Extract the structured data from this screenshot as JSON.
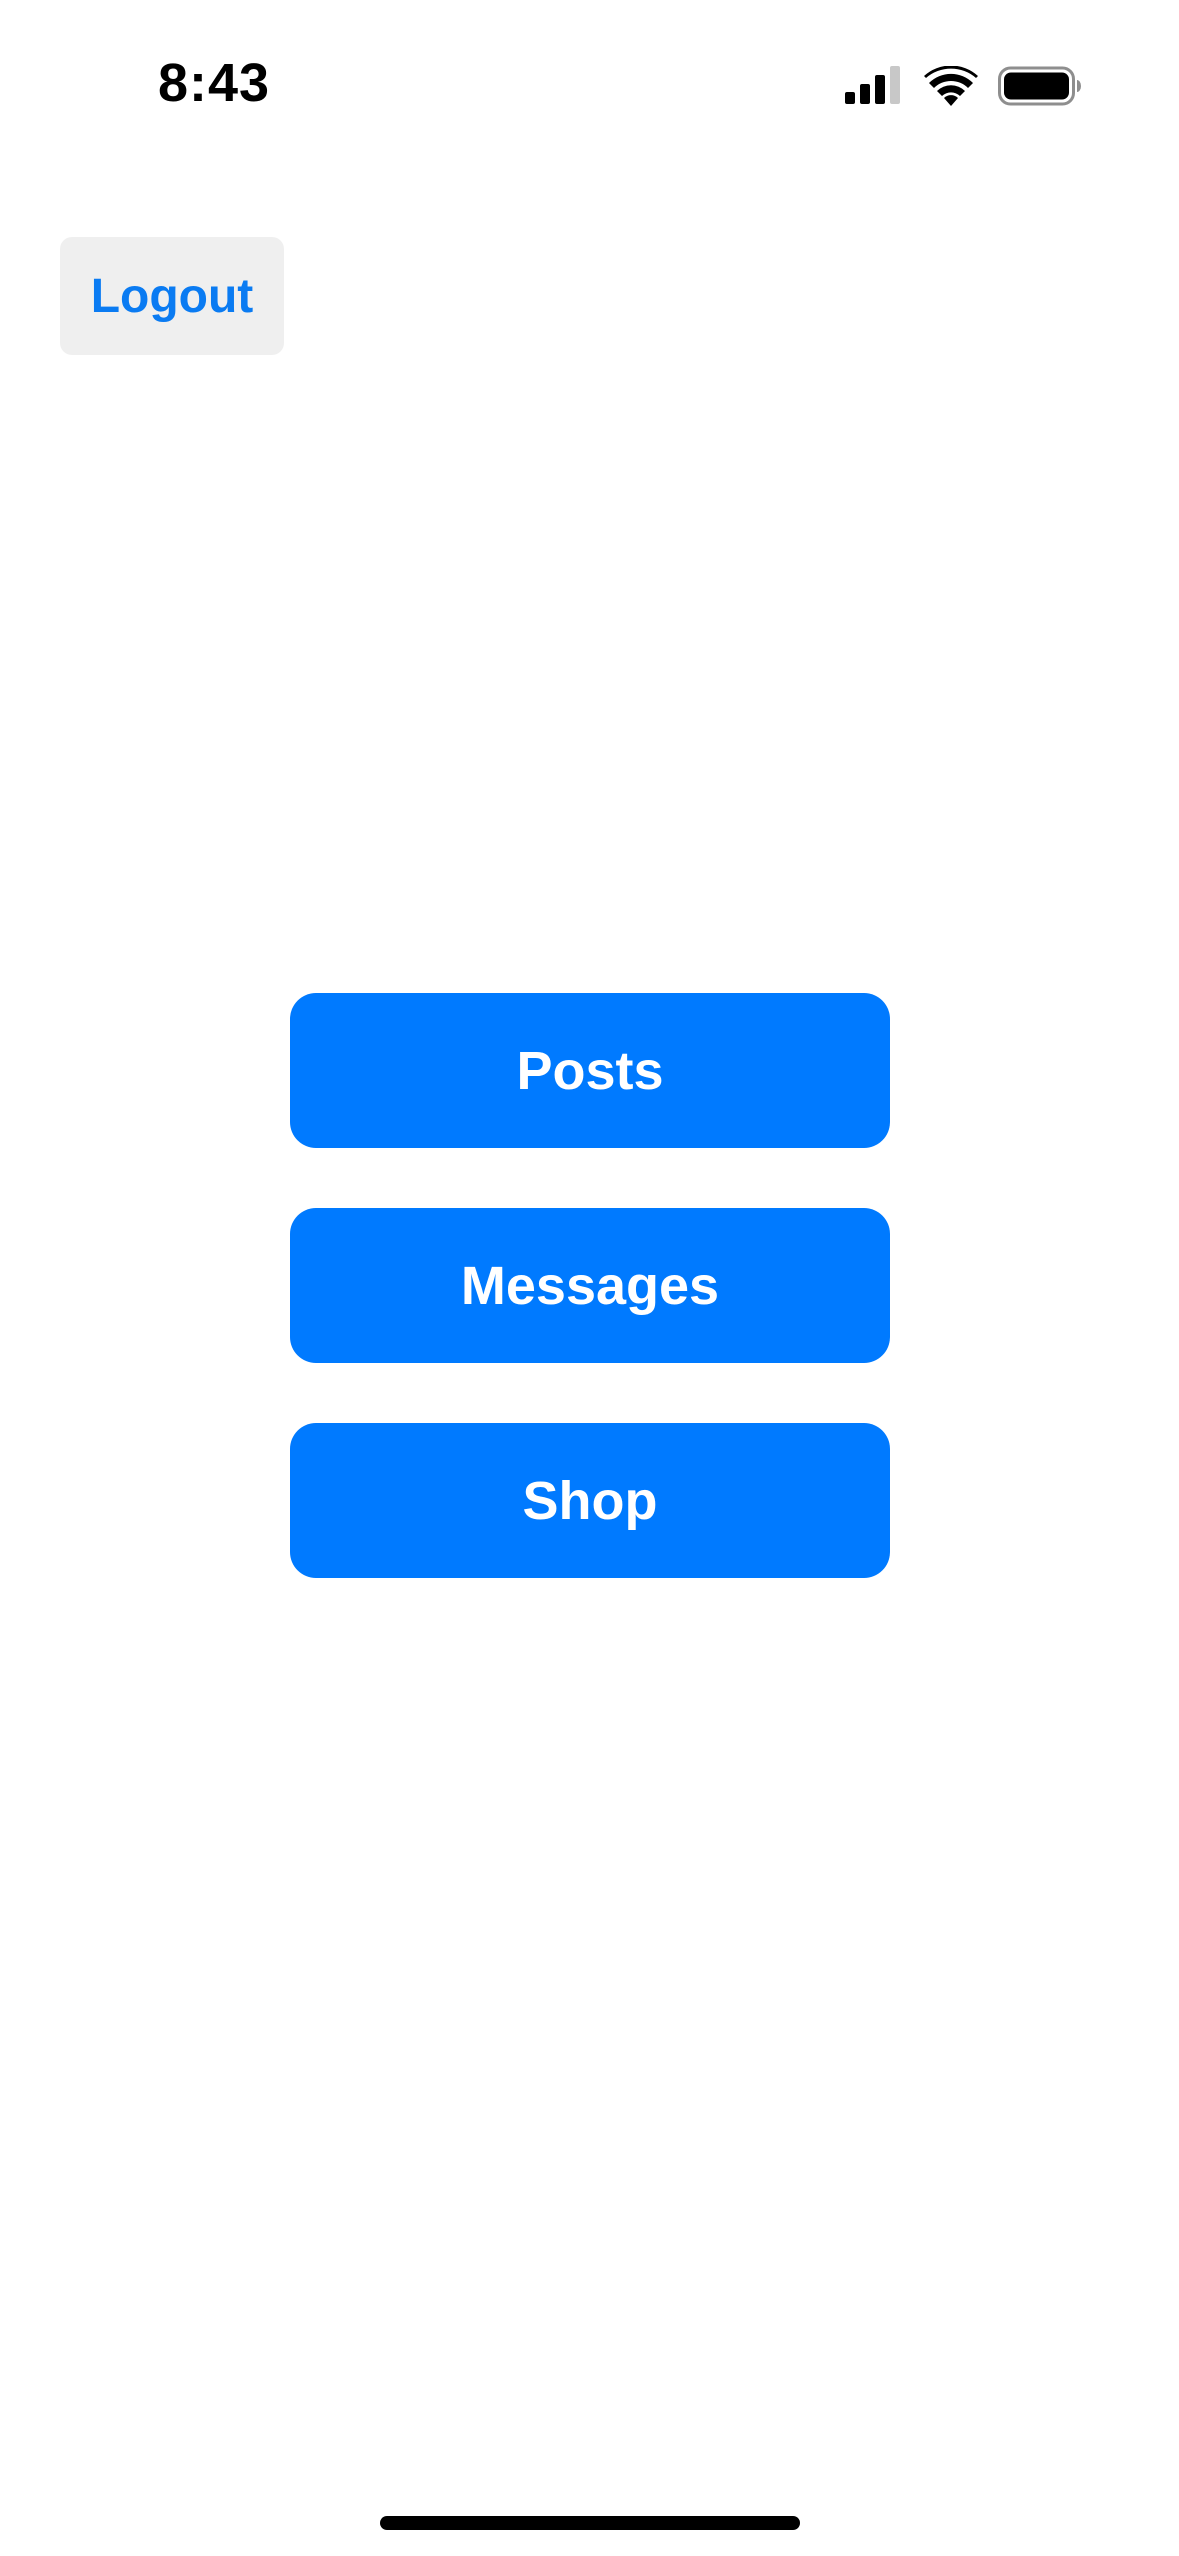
{
  "status_bar": {
    "time": "8:43",
    "signal_icon": "cellular-signal-icon",
    "wifi_icon": "wifi-icon",
    "battery_icon": "battery-icon"
  },
  "header": {
    "logout_label": "Logout"
  },
  "menu": {
    "items": [
      {
        "label": "Posts"
      },
      {
        "label": "Messages"
      },
      {
        "label": "Shop"
      }
    ]
  },
  "colors": {
    "accent": "#007AFF",
    "logout_text": "#0A7BF2",
    "logout_bg": "#EFEFEF",
    "background": "#FFFFFF"
  }
}
